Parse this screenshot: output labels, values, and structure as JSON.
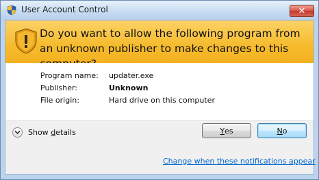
{
  "window": {
    "title": "User Account Control",
    "close_label": "✕"
  },
  "banner": {
    "question": "Do you want to allow the following program from an unknown publisher to make changes to this computer?"
  },
  "details": {
    "program_name_label": "Program name:",
    "program_name_value": "updater.exe",
    "publisher_label": "Publisher:",
    "publisher_value": "Unknown",
    "file_origin_label": "File origin:",
    "file_origin_value": "Hard drive on this computer"
  },
  "footer": {
    "show_details_pre": "Show ",
    "show_details_accel": "d",
    "show_details_post": "etails",
    "yes_accel": "Y",
    "yes_rest": "es",
    "no_accel": "N",
    "no_rest": "o",
    "notifications_link": "Change when these notifications appear"
  },
  "colors": {
    "banner": "#f6bb2d",
    "link": "#0066cc",
    "close_button": "#c3382b"
  },
  "icons": {
    "title": "uac-shield-icon",
    "banner": "warning-shield-icon",
    "details": "chevron-down-icon",
    "close": "close-icon"
  }
}
